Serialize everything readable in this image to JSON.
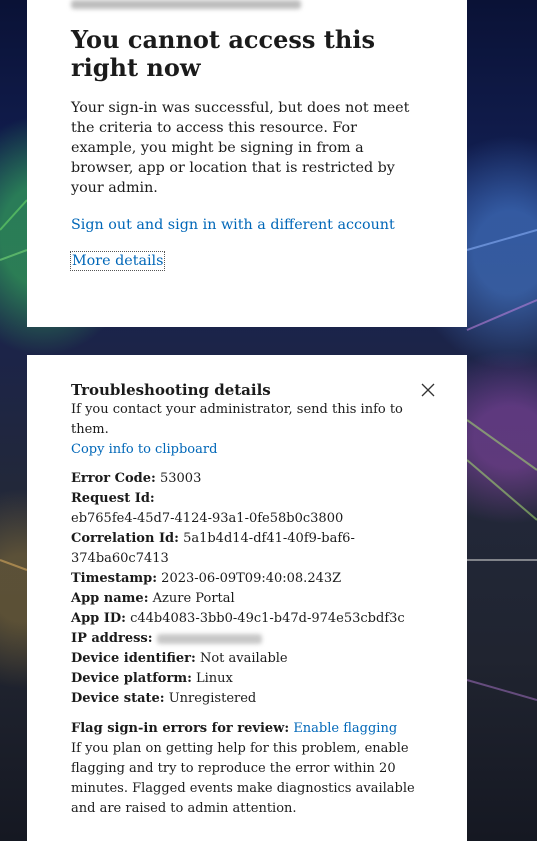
{
  "error_card": {
    "title": "You cannot access this right now",
    "message": "Your sign-in was successful, but does not meet the criteria to access this resource. For example, you might be signing in from a browser, app or location that is restricted by your admin.",
    "sign_out_link": "Sign out and sign in with a different account",
    "more_details_link": "More details"
  },
  "troubleshooting": {
    "title": "Troubleshooting details",
    "intro": "If you contact your administrator, send this info to them.",
    "copy_link": "Copy info to clipboard",
    "fields": {
      "error_code": {
        "label": "Error Code:",
        "value": "53003"
      },
      "request_id": {
        "label": "Request Id:",
        "value": "eb765fe4-45d7-4124-93a1-0fe58b0c3800"
      },
      "correlation_id": {
        "label": "Correlation Id:",
        "value": "5a1b4d14-df41-40f9-baf6-374ba60c7413"
      },
      "timestamp": {
        "label": "Timestamp:",
        "value": "2023-06-09T09:40:08.243Z"
      },
      "app_name": {
        "label": "App name:",
        "value": "Azure Portal"
      },
      "app_id": {
        "label": "App ID:",
        "value": "c44b4083-3bb0-49c1-b47d-974e53cbdf3c"
      },
      "ip_address": {
        "label": "IP address:"
      },
      "device_identifier": {
        "label": "Device identifier:",
        "value": "Not available"
      },
      "device_platform": {
        "label": "Device platform:",
        "value": "Linux"
      },
      "device_state": {
        "label": "Device state:",
        "value": "Unregistered"
      }
    },
    "flagging": {
      "label": "Flag sign-in errors for review:",
      "link": "Enable flagging",
      "description": "If you plan on getting help for this problem, enable flagging and try to reproduce the error within 20 minutes. Flagged events make diagnostics available and are raised to admin attention."
    }
  }
}
